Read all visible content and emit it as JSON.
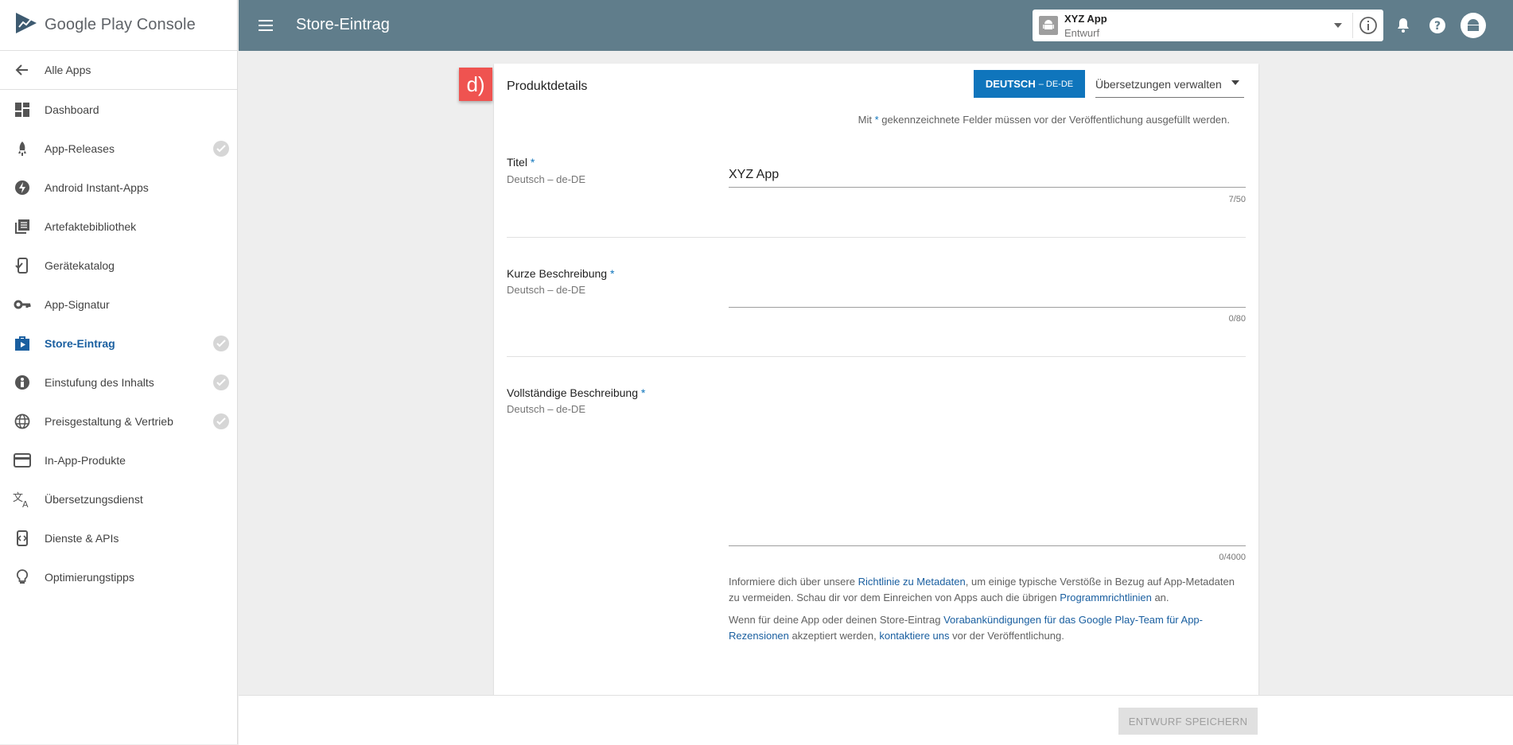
{
  "brand": {
    "logo_text": "Google Play Console"
  },
  "sidebar": {
    "back_label": "Alle Apps",
    "items": [
      {
        "label": "Dashboard",
        "icon": "dashboard-icon",
        "checked": false
      },
      {
        "label": "App-Releases",
        "icon": "rocket-icon",
        "checked": true
      },
      {
        "label": "Android Instant-Apps",
        "icon": "bolt-icon",
        "checked": false
      },
      {
        "label": "Artefaktebibliothek",
        "icon": "library-icon",
        "checked": false
      },
      {
        "label": "Gerätekatalog",
        "icon": "device-icon",
        "checked": false
      },
      {
        "label": "App-Signatur",
        "icon": "key-icon",
        "checked": false
      },
      {
        "label": "Store-Eintrag",
        "icon": "store-icon",
        "checked": true,
        "active": true
      },
      {
        "label": "Einstufung des Inhalts",
        "icon": "rating-icon",
        "checked": true
      },
      {
        "label": "Preisgestaltung & Vertrieb",
        "icon": "globe-icon",
        "checked": true
      },
      {
        "label": "In-App-Produkte",
        "icon": "card-icon",
        "checked": false
      },
      {
        "label": "Übersetzungsdienst",
        "icon": "translate-icon",
        "checked": false
      },
      {
        "label": "Dienste & APIs",
        "icon": "api-icon",
        "checked": false
      },
      {
        "label": "Optimierungstipps",
        "icon": "bulb-icon",
        "checked": false
      }
    ]
  },
  "topbar": {
    "title": "Store-Eintrag",
    "app_name": "XYZ App",
    "app_status": "Entwurf"
  },
  "card": {
    "badge": "d)",
    "title": "Produktdetails",
    "lang_main": "DEUTSCH",
    "lang_sub": "– DE-DE",
    "manage_translations": "Übersetzungen verwalten",
    "hint_pre": "Mit",
    "hint_star": "*",
    "hint_post": "gekennzeichnete Felder müssen vor der Veröffentlichung ausgefüllt werden.",
    "fields": {
      "title": {
        "label": "Titel",
        "sub": "Deutsch – de-DE",
        "value": "XYZ App",
        "counter": "7/50"
      },
      "short": {
        "label": "Kurze Beschreibung",
        "sub": "Deutsch – de-DE",
        "value": "",
        "counter": "0/80"
      },
      "full": {
        "label": "Vollständige Beschreibung",
        "sub": "Deutsch – de-DE",
        "value": "",
        "counter": "0/4000"
      }
    },
    "info1": {
      "t1": "Informiere dich über unsere ",
      "l1": "Richtlinie zu Metadaten",
      "t2": ", um einige typische Verstöße in Bezug auf App-Metadaten zu vermeiden. Schau dir vor dem Einreichen von Apps auch die übrigen ",
      "l2": "Programmrichtlinien",
      "t3": " an."
    },
    "info2": {
      "t1": "Wenn für deine App oder deinen Store-Eintrag ",
      "l1": "Vorabankündigungen für das Google Play-Team für App-Rezensionen",
      "t2": " akzeptiert werden, ",
      "l2": "kontaktiere uns",
      "t3": " vor der Veröffentlichung."
    }
  },
  "footer": {
    "save_label": "ENTWURF SPEICHERN"
  },
  "colors": {
    "topbar": "#607d8b",
    "accent": "#0f75bc",
    "badge": "#ef5350"
  }
}
